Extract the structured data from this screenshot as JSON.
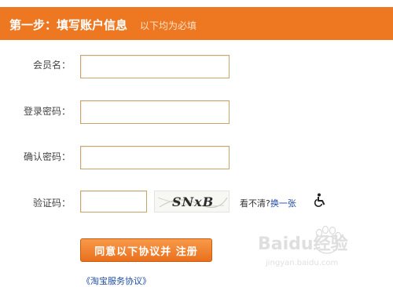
{
  "header": {
    "title": "第一步：填写账户信息",
    "subtitle": "以下均为必填",
    "background": "#ee7822"
  },
  "form": {
    "username_label": "会员名：",
    "password_label": "登录密码：",
    "confirm_label": "确认密码：",
    "captcha_label": "验证码：",
    "username_value": "",
    "password_value": "",
    "confirm_value": "",
    "captcha_value": "",
    "captcha_image_text": "SNxB",
    "cant_see_text": "看不清?",
    "refresh_link": "换一张",
    "accessibility_icon": "wheelchair-icon",
    "submit_label": "同意以下协议并 注册",
    "agreement_link": "《淘宝服务协议》"
  },
  "watermark": {
    "brand_text": "Baidu经验",
    "url_text": "jingyan.baidu.com"
  }
}
